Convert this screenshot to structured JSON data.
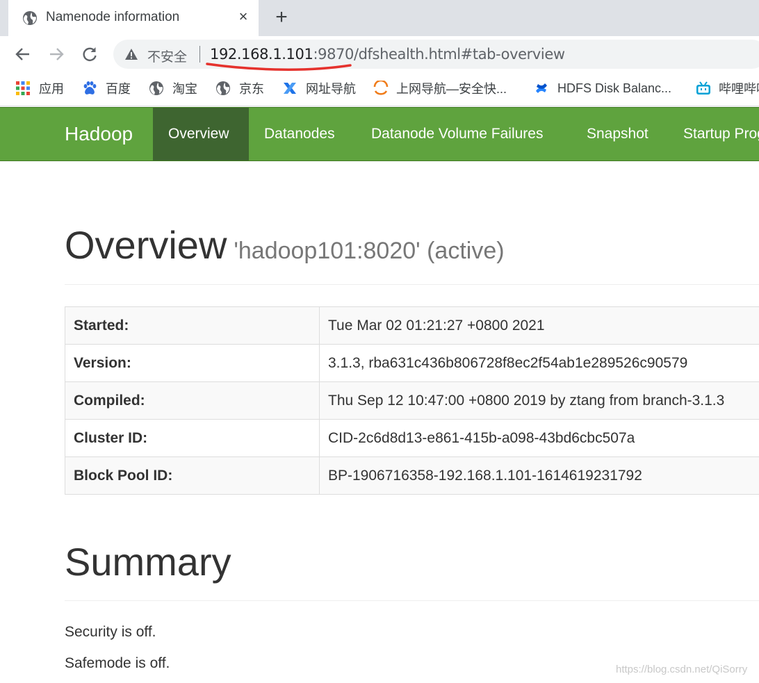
{
  "browser": {
    "tab_title": "Namenode information",
    "tab_close": "×",
    "new_tab": "+",
    "omnibox": {
      "security_label": "不安全",
      "url_host": "192.168.1.101",
      "url_rest": ":9870/dfshealth.html#tab-overview"
    },
    "bookmarks": [
      {
        "label": "应用",
        "icon": "apps-grid-icon"
      },
      {
        "label": "百度",
        "icon": "baidu-paw-icon"
      },
      {
        "label": "淘宝",
        "icon": "globe-icon"
      },
      {
        "label": "京东",
        "icon": "globe-icon"
      },
      {
        "label": "网址导航",
        "icon": "nav-x-icon"
      },
      {
        "label": "上网导航—安全快...",
        "icon": "orange-arc-icon"
      },
      {
        "label": "HDFS Disk Balanc...",
        "icon": "confluence-icon"
      },
      {
        "label": "哔哩哔哩",
        "icon": "bilibili-tv-icon"
      }
    ]
  },
  "hadoop_nav": {
    "brand": "Hadoop",
    "items": [
      "Overview",
      "Datanodes",
      "Datanode Volume Failures",
      "Snapshot",
      "Startup Progress"
    ],
    "active_index": 0,
    "color": "#5fa33e",
    "active_color": "#3e6530"
  },
  "overview": {
    "heading": "Overview",
    "subheading": "'hadoop101:8020' (active)",
    "rows": [
      {
        "key": "Started:",
        "value": "Tue Mar 02 01:21:27 +0800 2021"
      },
      {
        "key": "Version:",
        "value": "3.1.3, rba631c436b806728f8ec2f54ab1e289526c90579"
      },
      {
        "key": "Compiled:",
        "value": "Thu Sep 12 10:47:00 +0800 2019 by ztang from branch-3.1.3"
      },
      {
        "key": "Cluster ID:",
        "value": "CID-2c6d8d13-e861-415b-a098-43bd6cbc507a"
      },
      {
        "key": "Block Pool ID:",
        "value": "BP-1906716358-192.168.1.101-1614619231792"
      }
    ]
  },
  "summary": {
    "heading": "Summary",
    "security": "Security is off.",
    "safemode": "Safemode is off."
  },
  "watermark": "https://blog.csdn.net/QiSorry"
}
